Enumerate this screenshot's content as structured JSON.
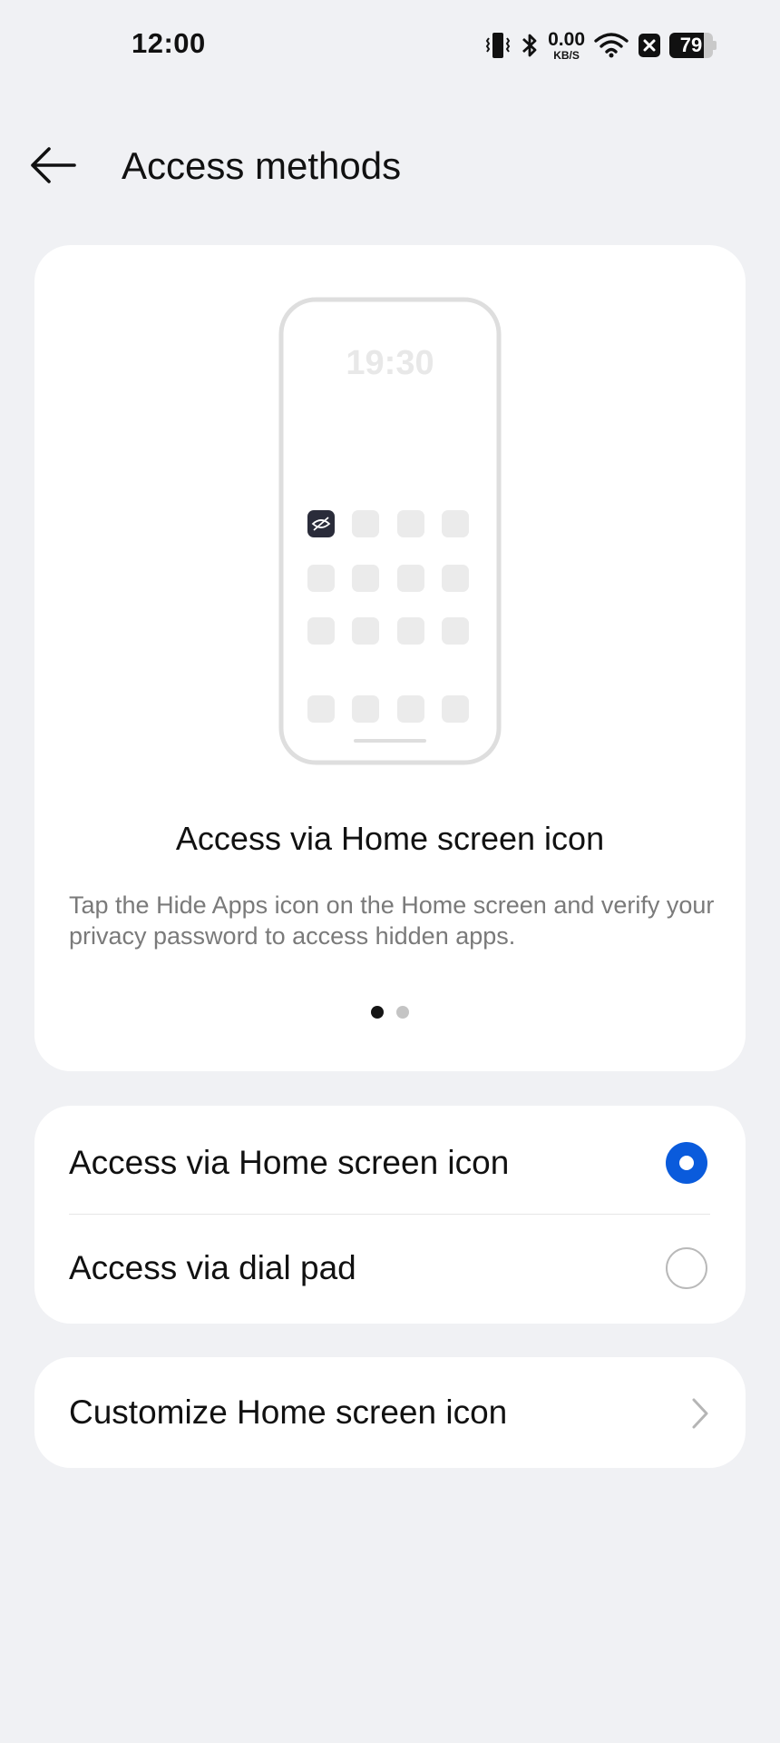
{
  "status_bar": {
    "time": "12:00",
    "network_speed_value": "0.00",
    "network_speed_unit": "KB/S",
    "battery_level": "79",
    "battery_fraction": 0.79,
    "icons": [
      "vibrate-icon",
      "bluetooth-icon",
      "wifi-icon",
      "notification-x-icon",
      "battery-icon"
    ]
  },
  "header": {
    "back_icon": "arrow-left-icon",
    "title": "Access methods"
  },
  "illustration": {
    "phone_clock": "19:30",
    "title": "Access via Home screen icon",
    "description": "Tap the Hide Apps icon on the Home screen and verify your privacy password to access hidden apps.",
    "page_count": 2,
    "active_page": 1
  },
  "options": {
    "items": [
      {
        "label": "Access via Home screen icon",
        "selected": true
      },
      {
        "label": "Access via dial pad",
        "selected": false
      }
    ]
  },
  "customize": {
    "label": "Customize Home screen icon",
    "icon": "chevron-right-icon"
  },
  "colors": {
    "background": "#f0f1f4",
    "card": "#ffffff",
    "accent": "#0a5bdc",
    "secondary_text": "#7a7a7a"
  }
}
